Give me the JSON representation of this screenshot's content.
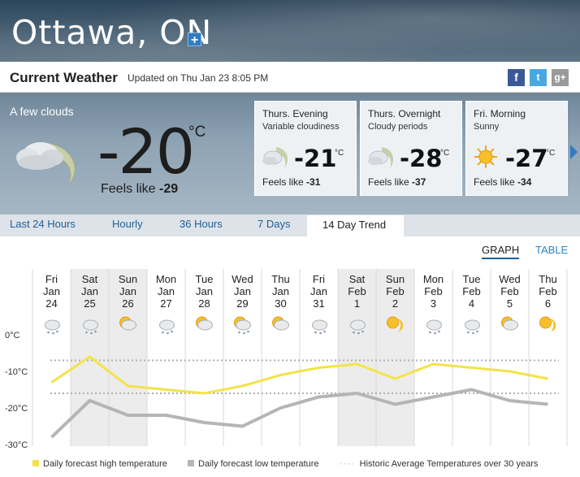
{
  "header": {
    "city": "Ottawa, ON",
    "add_label": "+"
  },
  "current_bar": {
    "title": "Current Weather",
    "updated": "Updated on Thu Jan 23 8:05 PM",
    "social": {
      "fb": "f",
      "tw": "t",
      "gp": "g+"
    }
  },
  "current": {
    "condition": "A few clouds",
    "temp": "-20",
    "unit": "°C",
    "feels_label": "Feels like",
    "feels_value": "-29"
  },
  "forecast_cards": [
    {
      "title": "Thurs. Evening",
      "desc": "Variable cloudiness",
      "temp": "-21",
      "unit": "°C",
      "feels_label": "Feels like",
      "feels_value": "-31",
      "icon": "cloudy-night-icon"
    },
    {
      "title": "Thurs. Overnight",
      "desc": "Cloudy periods",
      "temp": "-28",
      "unit": "°C",
      "feels_label": "Feels like",
      "feels_value": "-37",
      "icon": "cloudy-night-icon"
    },
    {
      "title": "Fri. Morning",
      "desc": "Sunny",
      "temp": "-27",
      "unit": "°C",
      "feels_label": "Feels like",
      "feels_value": "-34",
      "icon": "sun-icon"
    }
  ],
  "tabs": [
    "Last 24 Hours",
    "Hourly",
    "36 Hours",
    "7 Days",
    "14 Day Trend"
  ],
  "active_tab": "14 Day Trend",
  "view_toggle": {
    "graph": "GRAPH",
    "table": "TABLE"
  },
  "legend": {
    "high": "Daily forecast high temperature",
    "low": "Daily forecast low temperature",
    "historic": "Historic Average Temperatures over 30 years"
  },
  "colors": {
    "high": "#f2e34a",
    "low": "#b5b5b5",
    "historic": "#b0b0b0",
    "accent": "#1f5d97"
  },
  "chart_data": {
    "type": "line",
    "categories": [
      {
        "dow": "Fri",
        "mon": "Jan",
        "day": "24",
        "icon": "snow-cloud-icon"
      },
      {
        "dow": "Sat",
        "mon": "Jan",
        "day": "25",
        "icon": "snow-icon"
      },
      {
        "dow": "Sun",
        "mon": "Jan",
        "day": "26",
        "icon": "sun-cloud-icon"
      },
      {
        "dow": "Mon",
        "mon": "Jan",
        "day": "27",
        "icon": "snow-cloud-icon"
      },
      {
        "dow": "Tue",
        "mon": "Jan",
        "day": "28",
        "icon": "sun-cloud-icon"
      },
      {
        "dow": "Wed",
        "mon": "Jan",
        "day": "29",
        "icon": "sun-snow-icon"
      },
      {
        "dow": "Thu",
        "mon": "Jan",
        "day": "30",
        "icon": "sun-cloud-icon"
      },
      {
        "dow": "Fri",
        "mon": "Jan",
        "day": "31",
        "icon": "snow-cloud-icon"
      },
      {
        "dow": "Sat",
        "mon": "Feb",
        "day": "1",
        "icon": "snow-cloud-icon"
      },
      {
        "dow": "Sun",
        "mon": "Feb",
        "day": "2",
        "icon": "sun-icon"
      },
      {
        "dow": "Mon",
        "mon": "Feb",
        "day": "3",
        "icon": "snow-icon"
      },
      {
        "dow": "Tue",
        "mon": "Feb",
        "day": "4",
        "icon": "snow-cloud-icon"
      },
      {
        "dow": "Wed",
        "mon": "Feb",
        "day": "5",
        "icon": "sun-cloud-icon"
      },
      {
        "dow": "Thu",
        "mon": "Feb",
        "day": "6",
        "icon": "sun-icon"
      }
    ],
    "y_ticks": [
      "0°C",
      "-10°C",
      "-20°C",
      "-30°C"
    ],
    "y_tick_values": [
      0,
      -10,
      -20,
      -30
    ],
    "ylim": [
      -30,
      0
    ],
    "series": [
      {
        "name": "Daily forecast high temperature",
        "values": [
          -13,
          -6,
          -14,
          -15,
          -16,
          -14,
          -11,
          -9,
          -8,
          -12,
          -8,
          -9,
          -10,
          -12
        ]
      },
      {
        "name": "Daily forecast low temperature",
        "values": [
          -28,
          -18,
          -22,
          -22,
          -24,
          -25,
          -20,
          -17,
          -16,
          -19,
          -17,
          -15,
          -18,
          -19
        ]
      }
    ],
    "historic_high": -7,
    "historic_low": -16,
    "shaded_weekends": [
      1,
      2,
      8,
      9
    ]
  }
}
